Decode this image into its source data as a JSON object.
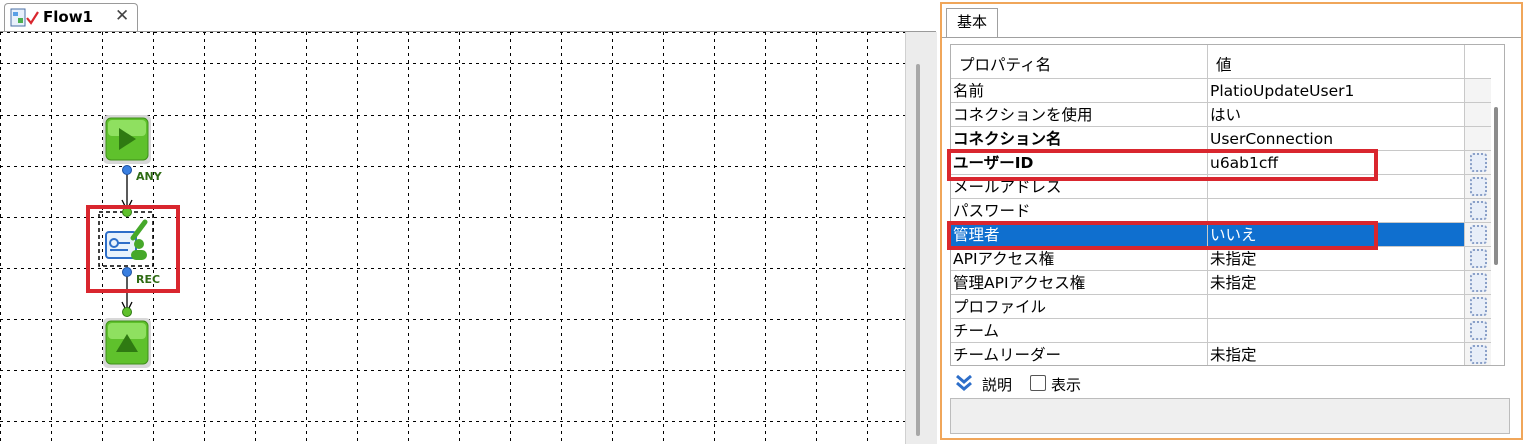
{
  "editor": {
    "tab_title": "Flow1",
    "close_symbol": "✕",
    "nodes": {
      "start_icon": "play-start-icon",
      "any_label": "ANY",
      "task_icon": "user-update-task-icon",
      "rec_label": "REC",
      "end_icon": "end-triangle-icon"
    }
  },
  "properties": {
    "tab_label": "基本",
    "header_name": "プロパティ名",
    "header_value": "値",
    "rows": [
      {
        "name": "名前",
        "value": "PlatioUpdateUser1"
      },
      {
        "name": "コネクションを使用",
        "value": "はい"
      },
      {
        "name": "コネクション名",
        "value": "UserConnection"
      },
      {
        "name": "ユーザーID",
        "value": "u6ab1cff"
      },
      {
        "name": "メールアドレス",
        "value": ""
      },
      {
        "name": "パスワード",
        "value": ""
      },
      {
        "name": "管理者",
        "value": "いいえ"
      },
      {
        "name": "APIアクセス権",
        "value": "未指定"
      },
      {
        "name": "管理APIアクセス権",
        "value": "未指定"
      },
      {
        "name": "プロファイル",
        "value": ""
      },
      {
        "name": "チーム",
        "value": ""
      },
      {
        "name": "チームリーダー",
        "value": "未指定"
      }
    ],
    "description_label": "説明",
    "show_label": "表示"
  },
  "colors": {
    "highlight": "#d9262e",
    "selection": "#0f6fcf",
    "panel_border": "#f0a65a",
    "node_green": "#5fc12c"
  }
}
